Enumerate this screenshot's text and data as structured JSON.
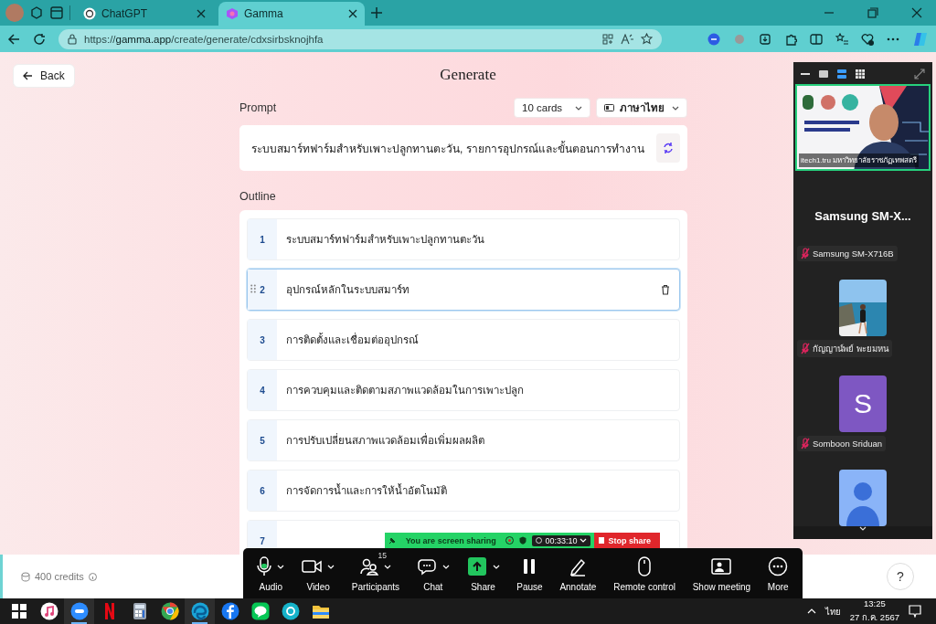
{
  "browser": {
    "tabs": [
      {
        "title": "ChatGPT",
        "selected": false
      },
      {
        "title": "Gamma",
        "selected": true
      }
    ],
    "url": {
      "scheme": "https://",
      "host": "gamma.app",
      "path": "/create/generate/cdxsirbsknojhfa"
    }
  },
  "page": {
    "back": "Back",
    "title": "Generate",
    "prompt_label": "Prompt",
    "cards_select": "10 cards",
    "language_select": "ภาษาไทย",
    "prompt": "ระบบสมาร์ทฟาร์มสำหรับเพาะปลูกทานตะวัน, รายการอุปกรณ์และขั้นตอนการทำงาน",
    "outline_label": "Outline",
    "outline": [
      {
        "number": "1",
        "text": "ระบบสมาร์ทฟาร์มสำหรับเพาะปลูกทานตะวัน",
        "selected": false
      },
      {
        "number": "2",
        "text": "อุปกรณ์หลักในระบบสมาร์ท",
        "selected": true
      },
      {
        "number": "3",
        "text": "การติดตั้งและเชื่อมต่ออุปกรณ์",
        "selected": false
      },
      {
        "number": "4",
        "text": "การควบคุมและติดตามสภาพแวดล้อมในการเพาะปลูก",
        "selected": false
      },
      {
        "number": "5",
        "text": "การปรับเปลี่ยนสภาพแวดล้อมเพื่อเพิ่มผลผลิต",
        "selected": false
      },
      {
        "number": "6",
        "text": "การจัดการน้ำและการให้น้ำอัตโนมัติ",
        "selected": false
      },
      {
        "number": "7",
        "selected": false
      }
    ],
    "credits": "400 credits",
    "help": "?"
  },
  "meeting_panel": {
    "video_label": "itech1.tru มหาวิทยาลัยราชภัฏเทพสตรี",
    "active_name": "Samsung  SM-X...",
    "participants": [
      {
        "kind": "none",
        "name": "Samsung SM-X716B"
      },
      {
        "name": "กัญญาน์พย์ พะยมหน"
      },
      {
        "kind": "letter",
        "letter": "S",
        "name": "Somboon Sriduan"
      },
      {
        "kind": "silhouette"
      }
    ]
  },
  "share_banner": {
    "text": "You are screen sharing",
    "timer": "00:33:10",
    "stop": "Stop share"
  },
  "meeting_toolbar": [
    {
      "kind": "audio",
      "label": "Audio",
      "menu": true
    },
    {
      "kind": "video",
      "label": "Video",
      "menu": true
    },
    {
      "kind": "participants",
      "label": "Participants",
      "menu": true,
      "badge": "15"
    },
    {
      "kind": "chat",
      "label": "Chat",
      "menu": true
    },
    {
      "kind": "share",
      "label": "Share",
      "menu": true
    },
    {
      "kind": "pause",
      "label": "Pause",
      "menu": false
    },
    {
      "kind": "annotate",
      "label": "Annotate",
      "menu": false
    },
    {
      "kind": "remote",
      "label": "Remote control",
      "menu": false
    },
    {
      "kind": "show",
      "label": "Show meeting",
      "menu": false
    },
    {
      "kind": "more",
      "label": "More",
      "menu": false
    }
  ],
  "taskbar": {
    "apps": [
      {
        "kind": "windows",
        "selected": false
      },
      {
        "kind": "music",
        "selected": false
      },
      {
        "kind": "zoom",
        "selected": true
      },
      {
        "kind": "netflix",
        "selected": false
      },
      {
        "kind": "calculator",
        "selected": false
      },
      {
        "kind": "chrome",
        "selected": false
      },
      {
        "kind": "edge",
        "selected": true
      },
      {
        "kind": "facebook",
        "selected": false
      },
      {
        "kind": "line",
        "selected": false
      },
      {
        "kind": "canva",
        "selected": false
      },
      {
        "kind": "folder",
        "selected": false
      }
    ],
    "language": "ไทย",
    "time": "13:25",
    "date": "27 ก.ค. 2567"
  }
}
